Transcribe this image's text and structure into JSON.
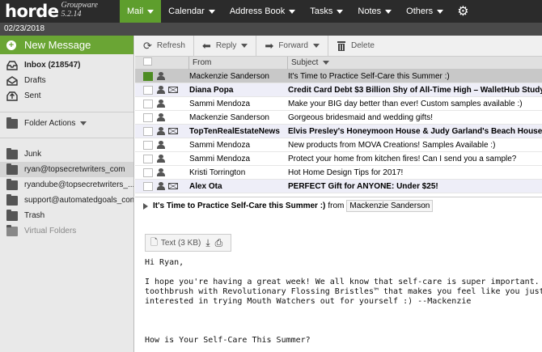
{
  "brand": {
    "name": "horde",
    "version": "Groupware 5.2.14"
  },
  "nav": [
    {
      "label": "Mail",
      "active": true
    },
    {
      "label": "Calendar"
    },
    {
      "label": "Address Book"
    },
    {
      "label": "Tasks"
    },
    {
      "label": "Notes"
    },
    {
      "label": "Others"
    }
  ],
  "date": "02/23/2018",
  "sidebar": {
    "new_message": "New Message",
    "inbox": "Inbox (218547)",
    "drafts": "Drafts",
    "sent": "Sent",
    "folder_actions": "Folder Actions",
    "folders": [
      "Junk",
      "ryan@topsecretwriters_com",
      "ryandube@topsecretwriters_...",
      "support@automatedgoals_com",
      "Trash"
    ],
    "virtual": "Virtual Folders"
  },
  "toolbar": {
    "refresh": "Refresh",
    "reply": "Reply",
    "forward": "Forward",
    "delete": "Delete"
  },
  "list": {
    "col_from": "From",
    "col_subject": "Subject",
    "rows": [
      {
        "from": "Mackenzie Sanderson",
        "subject": "It's Time to Practice Self-Care this Summer :)",
        "state": "selected",
        "env": false
      },
      {
        "from": "Diana Popa",
        "subject": "Credit Card Debt $3 Billion Shy of All-Time High – WalletHub Study",
        "state": "unread",
        "env": true
      },
      {
        "from": "Sammi Mendoza",
        "subject": "Make your BIG day better than ever! Custom samples available :)",
        "state": "read",
        "env": false
      },
      {
        "from": "Mackenzie Sanderson",
        "subject": "Gorgeous bridesmaid and wedding gifts!",
        "state": "read",
        "env": false
      },
      {
        "from": "TopTenRealEstateNews",
        "subject": "Elvis Presley's Honeymoon House & Judy Garland's Beach House",
        "state": "unread",
        "env": true
      },
      {
        "from": "Sammi Mendoza",
        "subject": "New products from MOVA Creations! Samples Available :)",
        "state": "read",
        "env": false
      },
      {
        "from": "Sammi Mendoza",
        "subject": "Protect your home from kitchen fires! Can I send you a sample?",
        "state": "read",
        "env": false
      },
      {
        "from": "Kristi Torrington",
        "subject": "Hot Home Design Tips for 2017!",
        "state": "read",
        "env": false
      },
      {
        "from": "Alex Ota",
        "subject": "PERFECT Gift for ANYONE: Under $25!",
        "state": "unread",
        "env": true
      }
    ]
  },
  "preview": {
    "subject": "It's Time to Practice Self-Care this Summer :)",
    "from_word": "from",
    "from": "Mackenzie Sanderson",
    "attachment": "Text (3 KB)",
    "body": "Hi Ryan,\n\nI hope you're having a great week! We all know that self-care is super important. As yo\ntoothbrush with Revolutionary Flossing Bristles™ that makes you feel like you just got\ninterested in trying Mouth Watchers out for yourself :) --Mackenzie\n\n\n\nHow is Your Self-Care This Summer?"
  }
}
